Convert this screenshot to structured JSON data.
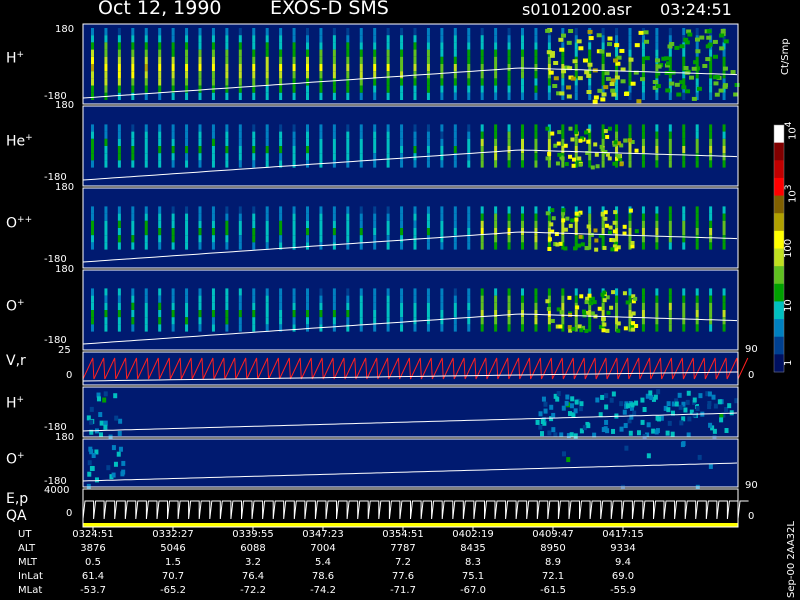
{
  "title": {
    "date": "Oct 12, 1990",
    "instrument": "EXOS-D SMS",
    "file": "s0101200.asr",
    "time": "03:24:51"
  },
  "panels": [
    {
      "id": "hplus",
      "label": "H",
      "sup": "+",
      "top_tick": "180",
      "bottom_tick": "-180"
    },
    {
      "id": "heplus",
      "label": "He",
      "sup": "+",
      "top_tick": "180",
      "bottom_tick": "-180"
    },
    {
      "id": "oplusplus",
      "label": "O",
      "sup": "++",
      "top_tick": "180",
      "bottom_tick": "-180"
    },
    {
      "id": "oplus",
      "label": "O",
      "sup": "+",
      "top_tick": "180",
      "bottom_tick": "-180"
    },
    {
      "id": "vr",
      "label": "V,r",
      "top_tick": "25",
      "bottom_tick": "0",
      "right_tick": "90",
      "right_bottom_tick": "0"
    },
    {
      "id": "hplus2",
      "label": "H",
      "sup": "+",
      "bottom_tick": "-180",
      "top_tick": "180"
    },
    {
      "id": "oplus2",
      "label": "O",
      "sup": "+",
      "top_tick": "180",
      "bottom_tick": "-180",
      "right_tick": "90"
    },
    {
      "id": "ep",
      "label": "E,p",
      "label2": "QA",
      "top_tick": "4000",
      "bottom_tick": "0",
      "right_tick": "0"
    }
  ],
  "colorbar": {
    "unit": "Ct/Smp",
    "ticks": [
      "10",
      "4",
      "10",
      "3",
      "100",
      "10",
      "1"
    ],
    "tick_labels": [
      {
        "base": "10",
        "exp": "4"
      },
      {
        "base": "10",
        "exp": "3"
      },
      {
        "base": "100",
        "exp": ""
      },
      {
        "base": "10",
        "exp": ""
      },
      {
        "base": "1",
        "exp": ""
      }
    ],
    "colors": [
      "#ffffff",
      "#800000",
      "#c00000",
      "#ff0000",
      "#806000",
      "#b0a000",
      "#ffff00",
      "#c0e020",
      "#60c020",
      "#00a000",
      "#00c0c0",
      "#0080c0",
      "#004090",
      "#001060"
    ]
  },
  "footer": {
    "rows": [
      {
        "label": "UT",
        "values": [
          "0324:51",
          "0332:27",
          "0339:55",
          "0347:23",
          "0354:51",
          "0402:19",
          "0409:47",
          "0417:15"
        ]
      },
      {
        "label": "ALT",
        "values": [
          "3876",
          "5046",
          "6088",
          "7004",
          "7787",
          "8435",
          "8950",
          "9334"
        ]
      },
      {
        "label": "MLT",
        "values": [
          "0.5",
          "1.5",
          "3.2",
          "5.4",
          "7.2",
          "8.3",
          "8.9",
          "9.4"
        ]
      },
      {
        "label": "InLat",
        "values": [
          "61.4",
          "70.7",
          "76.4",
          "78.6",
          "77.6",
          "75.1",
          "72.1",
          "69.0"
        ]
      },
      {
        "label": "MLat",
        "values": [
          "-53.7",
          "-65.2",
          "-72.2",
          "-74.2",
          "-71.7",
          "-67.0",
          "-61.5",
          "-55.9"
        ]
      }
    ],
    "side_note": "Sep-00 2AA32L"
  },
  "chart_data": {
    "type": "heatmap",
    "title": "Oct 12, 1990   EXOS-D SMS",
    "xlabel": "UT",
    "x_ticks": [
      "0324:51",
      "0332:27",
      "0339:55",
      "0347:23",
      "0354:51",
      "0402:19",
      "0409:47",
      "0417:15"
    ],
    "series": [
      {
        "name": "H+",
        "ylim": [
          -180,
          180
        ]
      },
      {
        "name": "He+",
        "ylim": [
          -180,
          180
        ]
      },
      {
        "name": "O++",
        "ylim": [
          -180,
          180
        ]
      },
      {
        "name": "O+",
        "ylim": [
          -180,
          180
        ]
      },
      {
        "name": "V,r",
        "ylim": [
          0,
          25
        ]
      },
      {
        "name": "H+",
        "ylim": [
          -180,
          180
        ]
      },
      {
        "name": "O+",
        "ylim": [
          -180,
          180
        ]
      },
      {
        "name": "E,p",
        "ylim": [
          0,
          4000
        ]
      }
    ],
    "colorscale_unit": "Ct/Smp",
    "colorscale_range": [
      1,
      10000
    ]
  }
}
